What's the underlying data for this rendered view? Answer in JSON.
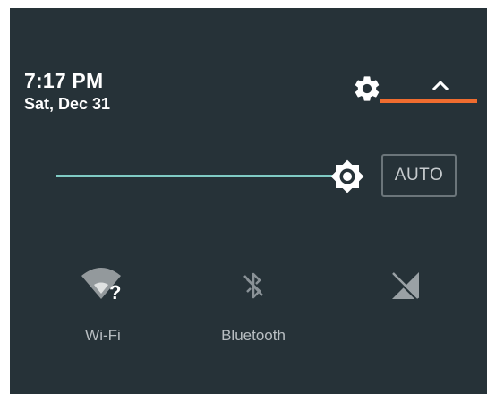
{
  "header": {
    "time": "7:17 PM",
    "date": "Sat, Dec 31"
  },
  "controls": {
    "settings_icon": "gear-icon",
    "expand_icon": "chevron-up-icon"
  },
  "brightness": {
    "level": 0.87,
    "auto_label": "AUTO"
  },
  "tiles": [
    {
      "label": "Wi-Fi",
      "icon": "wifi-unknown-icon"
    },
    {
      "label": "Bluetooth",
      "icon": "bluetooth-off-icon"
    },
    {
      "label": "",
      "icon": "cellular-off-icon"
    }
  ],
  "colors": {
    "panel_bg": "#263238",
    "slider_accent": "#80cbc4",
    "annotation_line": "#ef6c2f"
  }
}
